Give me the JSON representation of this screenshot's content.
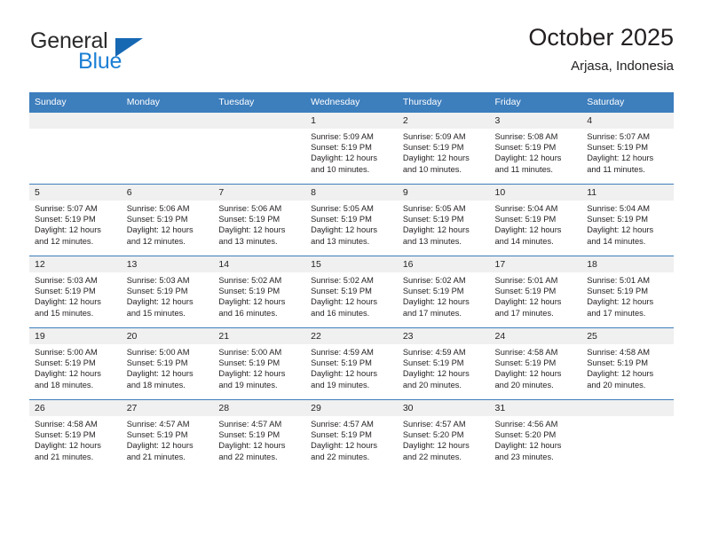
{
  "brand": {
    "name_part1": "General",
    "name_part2": "Blue",
    "logo_icon": "triangle-logo"
  },
  "header": {
    "title": "October 2025",
    "subtitle": "Arjasa, Indonesia"
  },
  "calendar": {
    "weekday_headers": [
      "Sunday",
      "Monday",
      "Tuesday",
      "Wednesday",
      "Thursday",
      "Friday",
      "Saturday"
    ],
    "accent_color": "#3d7ebd",
    "daynum_bg": "#f0f0f0",
    "weeks": [
      [
        {
          "day": "",
          "empty": true,
          "sunrise": "",
          "sunset": "",
          "daylight_line1": "",
          "daylight_line2": ""
        },
        {
          "day": "",
          "empty": true,
          "sunrise": "",
          "sunset": "",
          "daylight_line1": "",
          "daylight_line2": ""
        },
        {
          "day": "",
          "empty": true,
          "sunrise": "",
          "sunset": "",
          "daylight_line1": "",
          "daylight_line2": ""
        },
        {
          "day": "1",
          "empty": false,
          "sunrise": "Sunrise: 5:09 AM",
          "sunset": "Sunset: 5:19 PM",
          "daylight_line1": "Daylight: 12 hours",
          "daylight_line2": "and 10 minutes."
        },
        {
          "day": "2",
          "empty": false,
          "sunrise": "Sunrise: 5:09 AM",
          "sunset": "Sunset: 5:19 PM",
          "daylight_line1": "Daylight: 12 hours",
          "daylight_line2": "and 10 minutes."
        },
        {
          "day": "3",
          "empty": false,
          "sunrise": "Sunrise: 5:08 AM",
          "sunset": "Sunset: 5:19 PM",
          "daylight_line1": "Daylight: 12 hours",
          "daylight_line2": "and 11 minutes."
        },
        {
          "day": "4",
          "empty": false,
          "sunrise": "Sunrise: 5:07 AM",
          "sunset": "Sunset: 5:19 PM",
          "daylight_line1": "Daylight: 12 hours",
          "daylight_line2": "and 11 minutes."
        }
      ],
      [
        {
          "day": "5",
          "empty": false,
          "sunrise": "Sunrise: 5:07 AM",
          "sunset": "Sunset: 5:19 PM",
          "daylight_line1": "Daylight: 12 hours",
          "daylight_line2": "and 12 minutes."
        },
        {
          "day": "6",
          "empty": false,
          "sunrise": "Sunrise: 5:06 AM",
          "sunset": "Sunset: 5:19 PM",
          "daylight_line1": "Daylight: 12 hours",
          "daylight_line2": "and 12 minutes."
        },
        {
          "day": "7",
          "empty": false,
          "sunrise": "Sunrise: 5:06 AM",
          "sunset": "Sunset: 5:19 PM",
          "daylight_line1": "Daylight: 12 hours",
          "daylight_line2": "and 13 minutes."
        },
        {
          "day": "8",
          "empty": false,
          "sunrise": "Sunrise: 5:05 AM",
          "sunset": "Sunset: 5:19 PM",
          "daylight_line1": "Daylight: 12 hours",
          "daylight_line2": "and 13 minutes."
        },
        {
          "day": "9",
          "empty": false,
          "sunrise": "Sunrise: 5:05 AM",
          "sunset": "Sunset: 5:19 PM",
          "daylight_line1": "Daylight: 12 hours",
          "daylight_line2": "and 13 minutes."
        },
        {
          "day": "10",
          "empty": false,
          "sunrise": "Sunrise: 5:04 AM",
          "sunset": "Sunset: 5:19 PM",
          "daylight_line1": "Daylight: 12 hours",
          "daylight_line2": "and 14 minutes."
        },
        {
          "day": "11",
          "empty": false,
          "sunrise": "Sunrise: 5:04 AM",
          "sunset": "Sunset: 5:19 PM",
          "daylight_line1": "Daylight: 12 hours",
          "daylight_line2": "and 14 minutes."
        }
      ],
      [
        {
          "day": "12",
          "empty": false,
          "sunrise": "Sunrise: 5:03 AM",
          "sunset": "Sunset: 5:19 PM",
          "daylight_line1": "Daylight: 12 hours",
          "daylight_line2": "and 15 minutes."
        },
        {
          "day": "13",
          "empty": false,
          "sunrise": "Sunrise: 5:03 AM",
          "sunset": "Sunset: 5:19 PM",
          "daylight_line1": "Daylight: 12 hours",
          "daylight_line2": "and 15 minutes."
        },
        {
          "day": "14",
          "empty": false,
          "sunrise": "Sunrise: 5:02 AM",
          "sunset": "Sunset: 5:19 PM",
          "daylight_line1": "Daylight: 12 hours",
          "daylight_line2": "and 16 minutes."
        },
        {
          "day": "15",
          "empty": false,
          "sunrise": "Sunrise: 5:02 AM",
          "sunset": "Sunset: 5:19 PM",
          "daylight_line1": "Daylight: 12 hours",
          "daylight_line2": "and 16 minutes."
        },
        {
          "day": "16",
          "empty": false,
          "sunrise": "Sunrise: 5:02 AM",
          "sunset": "Sunset: 5:19 PM",
          "daylight_line1": "Daylight: 12 hours",
          "daylight_line2": "and 17 minutes."
        },
        {
          "day": "17",
          "empty": false,
          "sunrise": "Sunrise: 5:01 AM",
          "sunset": "Sunset: 5:19 PM",
          "daylight_line1": "Daylight: 12 hours",
          "daylight_line2": "and 17 minutes."
        },
        {
          "day": "18",
          "empty": false,
          "sunrise": "Sunrise: 5:01 AM",
          "sunset": "Sunset: 5:19 PM",
          "daylight_line1": "Daylight: 12 hours",
          "daylight_line2": "and 17 minutes."
        }
      ],
      [
        {
          "day": "19",
          "empty": false,
          "sunrise": "Sunrise: 5:00 AM",
          "sunset": "Sunset: 5:19 PM",
          "daylight_line1": "Daylight: 12 hours",
          "daylight_line2": "and 18 minutes."
        },
        {
          "day": "20",
          "empty": false,
          "sunrise": "Sunrise: 5:00 AM",
          "sunset": "Sunset: 5:19 PM",
          "daylight_line1": "Daylight: 12 hours",
          "daylight_line2": "and 18 minutes."
        },
        {
          "day": "21",
          "empty": false,
          "sunrise": "Sunrise: 5:00 AM",
          "sunset": "Sunset: 5:19 PM",
          "daylight_line1": "Daylight: 12 hours",
          "daylight_line2": "and 19 minutes."
        },
        {
          "day": "22",
          "empty": false,
          "sunrise": "Sunrise: 4:59 AM",
          "sunset": "Sunset: 5:19 PM",
          "daylight_line1": "Daylight: 12 hours",
          "daylight_line2": "and 19 minutes."
        },
        {
          "day": "23",
          "empty": false,
          "sunrise": "Sunrise: 4:59 AM",
          "sunset": "Sunset: 5:19 PM",
          "daylight_line1": "Daylight: 12 hours",
          "daylight_line2": "and 20 minutes."
        },
        {
          "day": "24",
          "empty": false,
          "sunrise": "Sunrise: 4:58 AM",
          "sunset": "Sunset: 5:19 PM",
          "daylight_line1": "Daylight: 12 hours",
          "daylight_line2": "and 20 minutes."
        },
        {
          "day": "25",
          "empty": false,
          "sunrise": "Sunrise: 4:58 AM",
          "sunset": "Sunset: 5:19 PM",
          "daylight_line1": "Daylight: 12 hours",
          "daylight_line2": "and 20 minutes."
        }
      ],
      [
        {
          "day": "26",
          "empty": false,
          "sunrise": "Sunrise: 4:58 AM",
          "sunset": "Sunset: 5:19 PM",
          "daylight_line1": "Daylight: 12 hours",
          "daylight_line2": "and 21 minutes."
        },
        {
          "day": "27",
          "empty": false,
          "sunrise": "Sunrise: 4:57 AM",
          "sunset": "Sunset: 5:19 PM",
          "daylight_line1": "Daylight: 12 hours",
          "daylight_line2": "and 21 minutes."
        },
        {
          "day": "28",
          "empty": false,
          "sunrise": "Sunrise: 4:57 AM",
          "sunset": "Sunset: 5:19 PM",
          "daylight_line1": "Daylight: 12 hours",
          "daylight_line2": "and 22 minutes."
        },
        {
          "day": "29",
          "empty": false,
          "sunrise": "Sunrise: 4:57 AM",
          "sunset": "Sunset: 5:19 PM",
          "daylight_line1": "Daylight: 12 hours",
          "daylight_line2": "and 22 minutes."
        },
        {
          "day": "30",
          "empty": false,
          "sunrise": "Sunrise: 4:57 AM",
          "sunset": "Sunset: 5:20 PM",
          "daylight_line1": "Daylight: 12 hours",
          "daylight_line2": "and 22 minutes."
        },
        {
          "day": "31",
          "empty": false,
          "sunrise": "Sunrise: 4:56 AM",
          "sunset": "Sunset: 5:20 PM",
          "daylight_line1": "Daylight: 12 hours",
          "daylight_line2": "and 23 minutes."
        },
        {
          "day": "",
          "empty": true,
          "sunrise": "",
          "sunset": "",
          "daylight_line1": "",
          "daylight_line2": ""
        }
      ]
    ]
  }
}
